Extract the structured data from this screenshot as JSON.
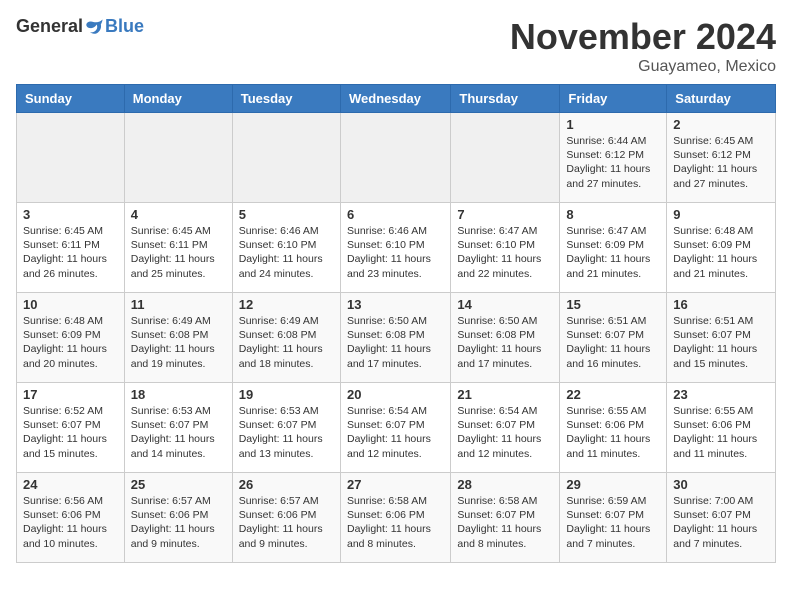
{
  "header": {
    "logo": {
      "general": "General",
      "blue": "Blue"
    },
    "title": "November 2024",
    "location": "Guayameo, Mexico"
  },
  "weekdays": [
    "Sunday",
    "Monday",
    "Tuesday",
    "Wednesday",
    "Thursday",
    "Friday",
    "Saturday"
  ],
  "weeks": [
    [
      {
        "day": "",
        "info": ""
      },
      {
        "day": "",
        "info": ""
      },
      {
        "day": "",
        "info": ""
      },
      {
        "day": "",
        "info": ""
      },
      {
        "day": "",
        "info": ""
      },
      {
        "day": "1",
        "info": "Sunrise: 6:44 AM\nSunset: 6:12 PM\nDaylight: 11 hours\nand 27 minutes."
      },
      {
        "day": "2",
        "info": "Sunrise: 6:45 AM\nSunset: 6:12 PM\nDaylight: 11 hours\nand 27 minutes."
      }
    ],
    [
      {
        "day": "3",
        "info": "Sunrise: 6:45 AM\nSunset: 6:11 PM\nDaylight: 11 hours\nand 26 minutes."
      },
      {
        "day": "4",
        "info": "Sunrise: 6:45 AM\nSunset: 6:11 PM\nDaylight: 11 hours\nand 25 minutes."
      },
      {
        "day": "5",
        "info": "Sunrise: 6:46 AM\nSunset: 6:10 PM\nDaylight: 11 hours\nand 24 minutes."
      },
      {
        "day": "6",
        "info": "Sunrise: 6:46 AM\nSunset: 6:10 PM\nDaylight: 11 hours\nand 23 minutes."
      },
      {
        "day": "7",
        "info": "Sunrise: 6:47 AM\nSunset: 6:10 PM\nDaylight: 11 hours\nand 22 minutes."
      },
      {
        "day": "8",
        "info": "Sunrise: 6:47 AM\nSunset: 6:09 PM\nDaylight: 11 hours\nand 21 minutes."
      },
      {
        "day": "9",
        "info": "Sunrise: 6:48 AM\nSunset: 6:09 PM\nDaylight: 11 hours\nand 21 minutes."
      }
    ],
    [
      {
        "day": "10",
        "info": "Sunrise: 6:48 AM\nSunset: 6:09 PM\nDaylight: 11 hours\nand 20 minutes."
      },
      {
        "day": "11",
        "info": "Sunrise: 6:49 AM\nSunset: 6:08 PM\nDaylight: 11 hours\nand 19 minutes."
      },
      {
        "day": "12",
        "info": "Sunrise: 6:49 AM\nSunset: 6:08 PM\nDaylight: 11 hours\nand 18 minutes."
      },
      {
        "day": "13",
        "info": "Sunrise: 6:50 AM\nSunset: 6:08 PM\nDaylight: 11 hours\nand 17 minutes."
      },
      {
        "day": "14",
        "info": "Sunrise: 6:50 AM\nSunset: 6:08 PM\nDaylight: 11 hours\nand 17 minutes."
      },
      {
        "day": "15",
        "info": "Sunrise: 6:51 AM\nSunset: 6:07 PM\nDaylight: 11 hours\nand 16 minutes."
      },
      {
        "day": "16",
        "info": "Sunrise: 6:51 AM\nSunset: 6:07 PM\nDaylight: 11 hours\nand 15 minutes."
      }
    ],
    [
      {
        "day": "17",
        "info": "Sunrise: 6:52 AM\nSunset: 6:07 PM\nDaylight: 11 hours\nand 15 minutes."
      },
      {
        "day": "18",
        "info": "Sunrise: 6:53 AM\nSunset: 6:07 PM\nDaylight: 11 hours\nand 14 minutes."
      },
      {
        "day": "19",
        "info": "Sunrise: 6:53 AM\nSunset: 6:07 PM\nDaylight: 11 hours\nand 13 minutes."
      },
      {
        "day": "20",
        "info": "Sunrise: 6:54 AM\nSunset: 6:07 PM\nDaylight: 11 hours\nand 12 minutes."
      },
      {
        "day": "21",
        "info": "Sunrise: 6:54 AM\nSunset: 6:07 PM\nDaylight: 11 hours\nand 12 minutes."
      },
      {
        "day": "22",
        "info": "Sunrise: 6:55 AM\nSunset: 6:06 PM\nDaylight: 11 hours\nand 11 minutes."
      },
      {
        "day": "23",
        "info": "Sunrise: 6:55 AM\nSunset: 6:06 PM\nDaylight: 11 hours\nand 11 minutes."
      }
    ],
    [
      {
        "day": "24",
        "info": "Sunrise: 6:56 AM\nSunset: 6:06 PM\nDaylight: 11 hours\nand 10 minutes."
      },
      {
        "day": "25",
        "info": "Sunrise: 6:57 AM\nSunset: 6:06 PM\nDaylight: 11 hours\nand 9 minutes."
      },
      {
        "day": "26",
        "info": "Sunrise: 6:57 AM\nSunset: 6:06 PM\nDaylight: 11 hours\nand 9 minutes."
      },
      {
        "day": "27",
        "info": "Sunrise: 6:58 AM\nSunset: 6:06 PM\nDaylight: 11 hours\nand 8 minutes."
      },
      {
        "day": "28",
        "info": "Sunrise: 6:58 AM\nSunset: 6:07 PM\nDaylight: 11 hours\nand 8 minutes."
      },
      {
        "day": "29",
        "info": "Sunrise: 6:59 AM\nSunset: 6:07 PM\nDaylight: 11 hours\nand 7 minutes."
      },
      {
        "day": "30",
        "info": "Sunrise: 7:00 AM\nSunset: 6:07 PM\nDaylight: 11 hours\nand 7 minutes."
      }
    ]
  ]
}
